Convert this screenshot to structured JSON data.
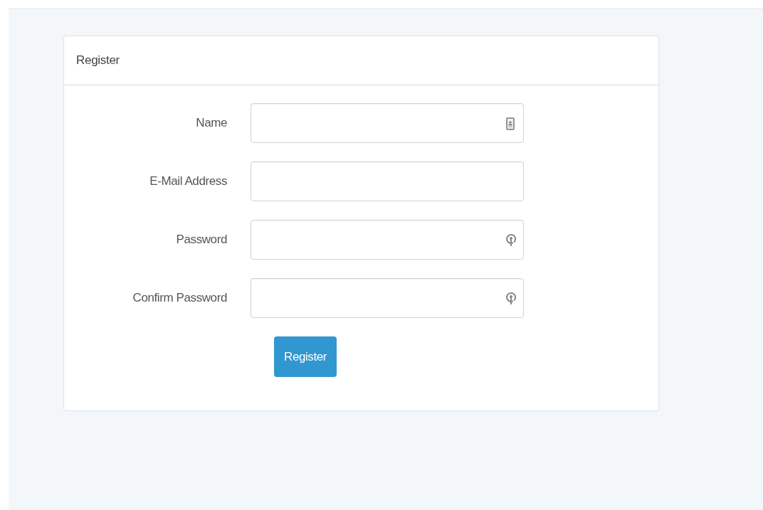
{
  "card": {
    "title": "Register"
  },
  "fields": [
    {
      "label": "Name",
      "kind": "contact"
    },
    {
      "label": "E-Mail Address",
      "kind": "plain"
    },
    {
      "label": "Password",
      "kind": "key"
    },
    {
      "label": "Confirm Password",
      "kind": "key"
    }
  ],
  "submit": {
    "label": "Register"
  }
}
